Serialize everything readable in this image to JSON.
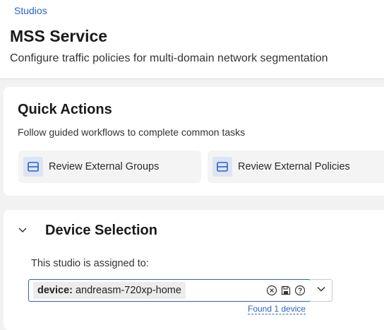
{
  "header": {
    "breadcrumb": "Studios",
    "title": "MSS Service",
    "subtitle": "Configure traffic policies for multi-domain network segmentation"
  },
  "quick_actions": {
    "title": "Quick Actions",
    "description": "Follow guided workflows to complete common tasks",
    "buttons": [
      {
        "label": "Review External Groups",
        "icon": "table-icon"
      },
      {
        "label": "Review External Policies",
        "icon": "table-icon"
      }
    ]
  },
  "device_selection": {
    "title": "Device Selection",
    "assigned_label": "This studio is assigned to:",
    "query": {
      "key": "device:",
      "value": "andreasm-720xp-home"
    },
    "found_text": "Found 1 device"
  },
  "colors": {
    "accent": "#2b63c9",
    "icon_bg": "#dde5f3",
    "page_bg": "#f2f2f2"
  }
}
